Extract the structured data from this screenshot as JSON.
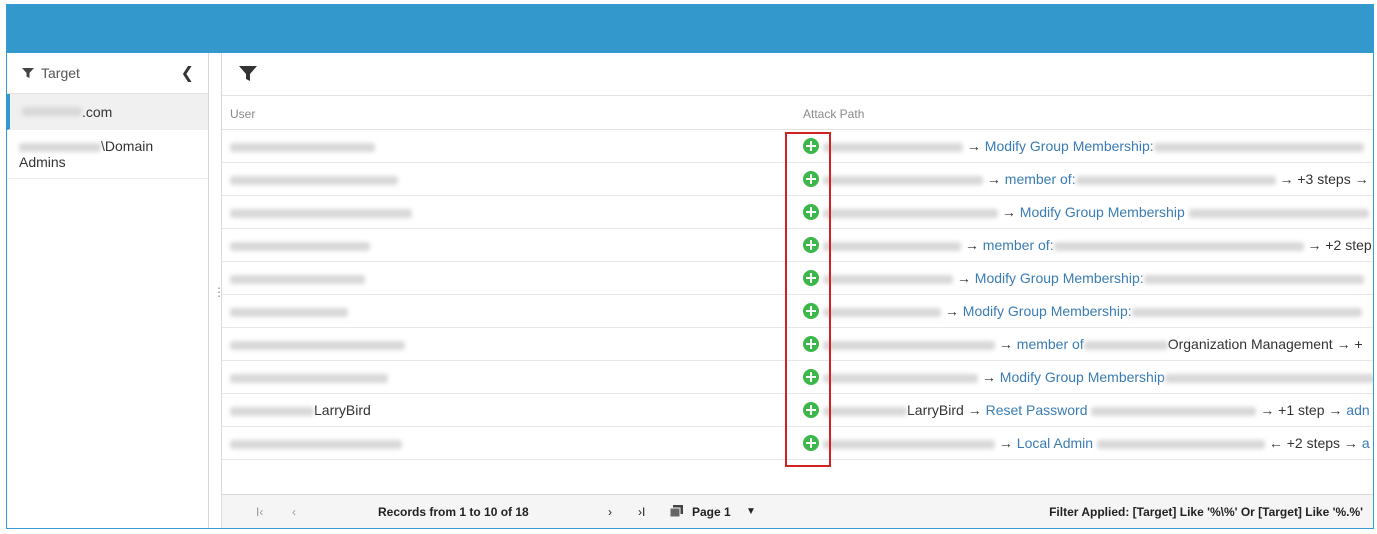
{
  "sidebar": {
    "header_label": "Target",
    "items": [
      {
        "suffix": ".com"
      },
      {
        "suffix": "\\Domain Admins"
      }
    ]
  },
  "columns": {
    "user": "User",
    "attack_path": "Attack Path"
  },
  "rows": [
    {
      "user": "",
      "parts": [
        "→",
        "Modify Group Membership:",
        ""
      ]
    },
    {
      "user": "",
      "parts": [
        "→",
        "member of:",
        "→ +3 steps →"
      ]
    },
    {
      "user": "",
      "parts": [
        "→",
        "Modify Group Membership",
        ""
      ]
    },
    {
      "user": "",
      "parts": [
        "→",
        "member of:",
        "→ +2 step"
      ]
    },
    {
      "user": "",
      "parts": [
        "→",
        "Modify Group Membership:",
        ""
      ]
    },
    {
      "user": "",
      "parts": [
        "→",
        "Modify Group Membership:",
        ""
      ]
    },
    {
      "user": "",
      "parts": [
        "→",
        "member of",
        "Organization Management → +"
      ]
    },
    {
      "user": "",
      "parts": [
        "→",
        "Modify Group Membership",
        ""
      ]
    },
    {
      "user": "LarryBird",
      "parts": [
        "LarryBird →",
        "Reset Password",
        "→ +1 step →"
      ],
      "tail_link": "adn"
    },
    {
      "user": "",
      "parts": [
        "→",
        "Local Admin",
        "← +2 steps →"
      ],
      "tail_link": "a"
    }
  ],
  "footer": {
    "first": "I‹",
    "prev": "‹",
    "records": "Records from 1 to 10 of 18",
    "next": "›",
    "last": "›I",
    "page_label": "Page 1",
    "filter": "Filter Applied: [Target] Like '%\\%' Or [Target] Like '%.%'"
  }
}
